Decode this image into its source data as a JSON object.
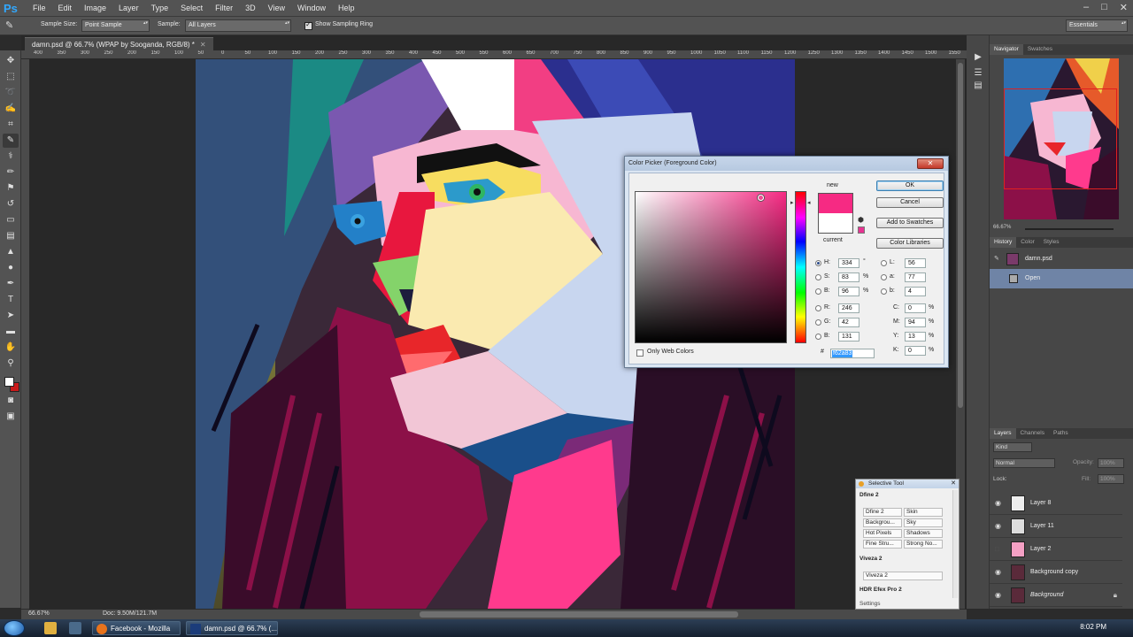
{
  "app": {
    "name": "Ps",
    "menus": [
      "File",
      "Edit",
      "Image",
      "Layer",
      "Type",
      "Select",
      "Filter",
      "3D",
      "View",
      "Window",
      "Help"
    ],
    "window_controls": [
      "–",
      "□",
      "✕"
    ]
  },
  "options": {
    "sample_size_label": "Sample Size:",
    "sample_size_value": "Point Sample",
    "sample_label": "Sample:",
    "sample_value": "All Layers",
    "show_ring_label": "Show Sampling Ring",
    "workspace": "Essentials"
  },
  "document": {
    "tab_title": "damn.psd @ 66.7% (WPAP by Sooganda, RGB/8) *",
    "ruler_ticks": [
      "400",
      "350",
      "300",
      "250",
      "200",
      "150",
      "100",
      "50",
      "0",
      "50",
      "100",
      "150",
      "200",
      "250",
      "300",
      "350",
      "400",
      "450",
      "500",
      "550",
      "600",
      "650",
      "700",
      "750",
      "800",
      "850",
      "900",
      "950",
      "1000",
      "1050",
      "1100",
      "1150",
      "1200",
      "1250",
      "1300",
      "1350",
      "1400",
      "1450",
      "1500",
      "1550"
    ],
    "zoom": "66.67%",
    "doc_size": "Doc: 9.50M/121.7M"
  },
  "color_picker": {
    "title": "Color Picker (Foreground Color)",
    "new_label": "new",
    "current_label": "current",
    "new_color": "#f62a83",
    "current_color": "#ffffff",
    "buttons": {
      "ok": "OK",
      "cancel": "Cancel",
      "add_swatches": "Add to Swatches",
      "color_libraries": "Color Libraries"
    },
    "fields": {
      "H": "334",
      "S": "83",
      "B": "96",
      "R": "246",
      "G": "42",
      "Bv": "131",
      "L": "56",
      "a": "77",
      "b": "4",
      "C": "0",
      "M": "94",
      "Y": "13",
      "K": "0"
    },
    "labels": {
      "H": "H:",
      "S": "S:",
      "B": "B:",
      "R": "R:",
      "G": "G:",
      "Bv": "B:",
      "L": "L:",
      "a": "a:",
      "b": "b:",
      "C": "C:",
      "M": "M:",
      "Y": "Y:",
      "K": "K:"
    },
    "units": {
      "deg": "°",
      "pct": "%"
    },
    "hex_label": "#",
    "hex": "f62a83",
    "only_web_label": "Only Web Colors"
  },
  "navigator": {
    "tabs": [
      "Navigator",
      "Swatches"
    ],
    "zoom": "66.67%"
  },
  "history": {
    "tabs": [
      "History",
      "Color",
      "Styles"
    ],
    "items": [
      "damn.psd",
      "Open"
    ]
  },
  "layers": {
    "tabs": [
      "Layers",
      "Channels",
      "Paths"
    ],
    "kind": "Kind",
    "blend_mode": "Normal",
    "opacity_label": "Opacity:",
    "opacity": "100%",
    "lock_label": "Lock:",
    "fill_label": "Fill:",
    "fill": "100%",
    "items": [
      "Layer 8",
      "Layer 11",
      "Layer 2",
      "Background copy",
      "Background"
    ]
  },
  "selective_tool": {
    "title": "Selective Tool",
    "dfine_head": "Dfine 2",
    "dfine_cells": [
      "Dfine 2",
      "Skin",
      "Backgrou...",
      "Sky",
      "Hot Pixels",
      "Shadows",
      "Fine Stru...",
      "Strong No..."
    ],
    "viveza_head": "Viveza 2",
    "viveza_cell": "Viveza 2",
    "hdr_head": "HDR Efex Pro 2",
    "settings": "Settings"
  },
  "taskbar": {
    "tasks": [
      "Facebook - Mozilla F...",
      "damn.psd @ 66.7% (..."
    ],
    "time": "8:02 PM"
  }
}
